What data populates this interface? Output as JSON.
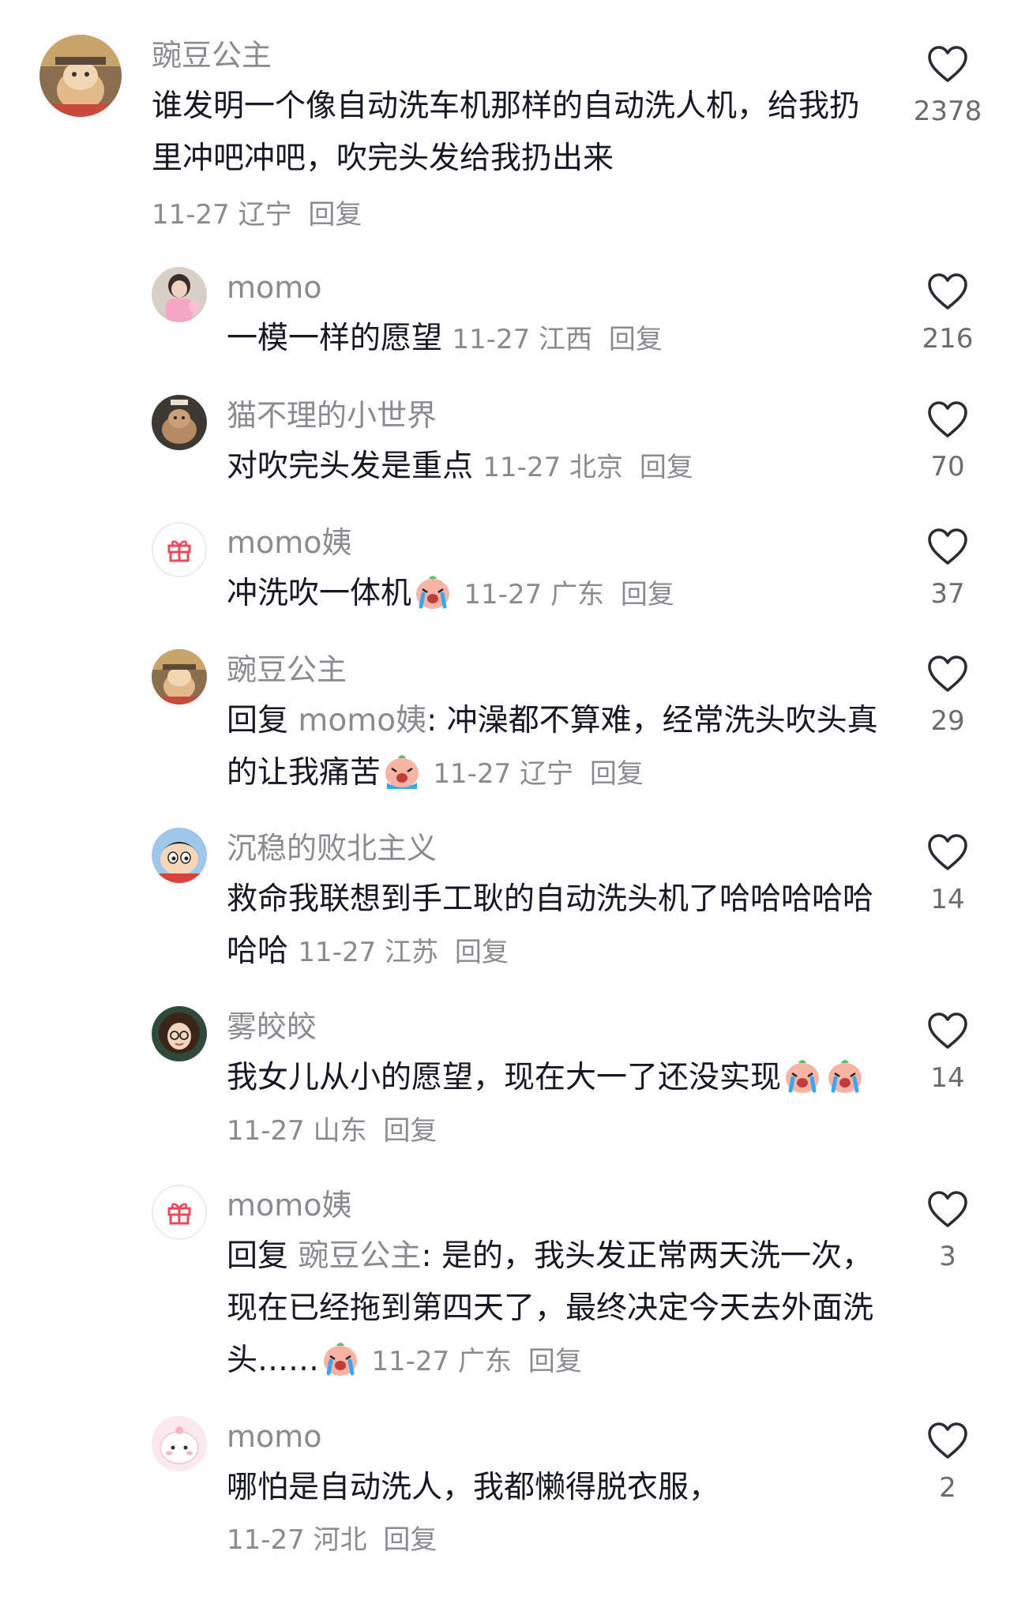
{
  "comment_main": {
    "nickname": "豌豆公主",
    "text": "谁发明一个像自动洗车机那样的自动洗人机，给我扔里冲吧冲吧，吹完头发给我扔出来",
    "date": "11-27",
    "location": "辽宁",
    "reply_label": "回复",
    "likes": "2378"
  },
  "replies": [
    {
      "nickname": "momo",
      "text": "一模一样的愿望",
      "date": "11-27",
      "location": "江西",
      "reply_label": "回复",
      "likes": "216"
    },
    {
      "nickname": "猫不理的小世界",
      "text": "对吹完头发是重点",
      "date": "11-27",
      "location": "北京",
      "reply_label": "回复",
      "likes": "70"
    },
    {
      "nickname": "momo姨",
      "text": "冲洗吹一体机",
      "date": "11-27",
      "location": "广东",
      "reply_label": "回复",
      "likes": "37"
    },
    {
      "nickname": "豌豆公主",
      "reply_prefix": "回复",
      "reply_to": "momo姨",
      "colon": ":",
      "text": " 冲澡都不算难，经常洗头吹头真的让我痛苦",
      "date": "11-27",
      "location": "辽宁",
      "reply_label": "回复",
      "likes": "29"
    },
    {
      "nickname": "沉稳的败北主义",
      "text": "救命我联想到手工耿的自动洗头机了哈哈哈哈哈哈哈",
      "date": "11-27",
      "location": "江苏",
      "reply_label": "回复",
      "likes": "14"
    },
    {
      "nickname": "雾皎皎",
      "text": "我女儿从小的愿望，现在大一了还没实现",
      "date": "11-27",
      "location": "山东",
      "reply_label": "回复",
      "likes": "14"
    },
    {
      "nickname": "momo姨",
      "reply_prefix": "回复",
      "reply_to": "豌豆公主",
      "colon": ":",
      "text": " 是的，我头发正常两天洗一次，现在已经拖到第四天了，最终决定今天去外面洗头……",
      "date": "11-27",
      "location": "广东",
      "reply_label": "回复",
      "likes": "3"
    },
    {
      "nickname": "momo",
      "text": "哪怕是自动洗人，我都懒得脱衣服，",
      "date": "11-27",
      "location": "河北",
      "reply_label": "回复",
      "likes": "2"
    }
  ],
  "icons": {
    "heart": "heart-outline-icon",
    "gift": "gift-icon",
    "emoji_cry": "crying-face-emoji"
  },
  "colors": {
    "text": "#161823",
    "muted": "#8a8b91",
    "emoji_face": "#f7b3a4",
    "emoji_tear": "#3aa6f3"
  }
}
